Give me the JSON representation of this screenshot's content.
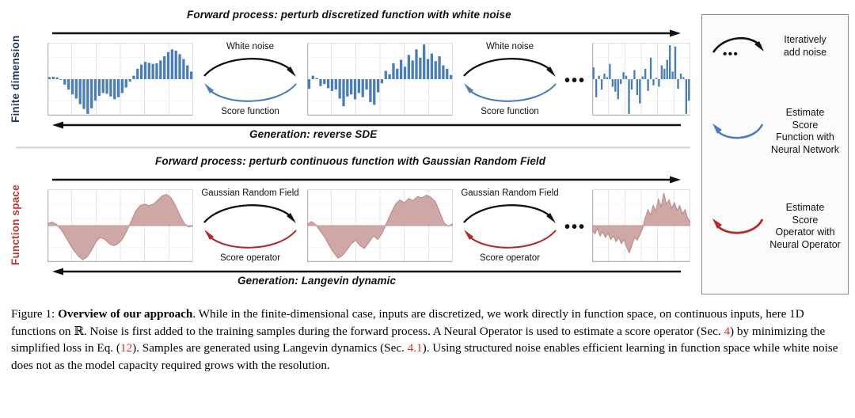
{
  "rows": [
    {
      "id": "finite-dimension",
      "axis_label": "Finite dimension",
      "axis_color": "#1F3864",
      "forward_caption": "Forward process: perturb discretized function with white noise",
      "reverse_caption": "Generation: reverse SDE",
      "connector_top_label": "White noise",
      "connector_bottom_label": "Score function",
      "series_color": "#4A7EBB",
      "ellipsis": "•••"
    },
    {
      "id": "function-space",
      "axis_label": "Function space",
      "axis_color": "#C0392B",
      "forward_caption": "Forward process: perturb continuous function with Gaussian Random Field",
      "reverse_caption": "Generation: Langevin dynamic",
      "connector_top_label": "Gaussian Random Field",
      "connector_bottom_label": "Score operator",
      "series_color": "#C0392B",
      "fill_color": "#CCA0A0",
      "ellipsis": "•••"
    }
  ],
  "legend": {
    "items": [
      {
        "glyph": "black-arc-arrow-with-dots",
        "color": "#111111",
        "dots": "•••",
        "label": "Iteratively\nadd noise"
      },
      {
        "glyph": "blue-arc-arrow-left",
        "color": "#4A7EBB",
        "dots": "",
        "label": "Estimate\nScore\nFunction with\nNeural Network"
      },
      {
        "glyph": "red-arc-arrow-left",
        "color": "#B52A26",
        "dots": "",
        "label": "Estimate\nScore\nOperator with\nNeural Operator"
      }
    ]
  },
  "caption": {
    "figure_label": "Figure 1:",
    "bold_title": "Overview of our approach",
    "part1": ". While in the finite-dimensional case, inputs are discretized, we work directly in function space, on continuous inputs, here 1D functions on ",
    "blackboard_R": "ℝ",
    "part2": ". Noise is first added to the training samples during the forward process. A Neural Operator is used to estimate a score operator (Sec. ",
    "ref_sec4": "4",
    "part3": ") by minimizing the simplified loss in Eq. (",
    "ref_eq12": "12",
    "part4": "). Samples are generated using Langevin dynamics (Sec. ",
    "ref_sec41": "4.1",
    "part5": "). Using structured noise enables efficient learning in function space while white noise does not as the model capacity required grows with the resolution."
  },
  "chart_data": [
    {
      "type": "bar",
      "title": "Finite dimension — clean discretized signal",
      "panel": "top-left",
      "xlabel": "",
      "ylabel": "",
      "grid": true,
      "ylim": [
        -1.05,
        1.05
      ],
      "color": "#4A7EBB",
      "values": [
        0.06,
        0.07,
        0.05,
        -0.02,
        -0.16,
        -0.3,
        -0.44,
        -0.56,
        -0.72,
        -0.86,
        -1.0,
        -0.84,
        -0.62,
        -0.48,
        -0.4,
        -0.42,
        -0.5,
        -0.58,
        -0.52,
        -0.4,
        -0.24,
        -0.07,
        0.1,
        0.3,
        0.42,
        0.5,
        0.47,
        0.44,
        0.46,
        0.54,
        0.66,
        0.78,
        0.86,
        0.82,
        0.72,
        0.58,
        0.4,
        0.22
      ]
    },
    {
      "type": "bar",
      "title": "Finite dimension — partially noised signal",
      "panel": "top-middle",
      "xlabel": "",
      "ylabel": "",
      "grid": true,
      "ylim": [
        -1.05,
        1.05
      ],
      "color": "#4A7EBB",
      "values": [
        -0.28,
        0.1,
        0.03,
        -0.2,
        -0.14,
        -0.26,
        -0.34,
        -0.3,
        -0.56,
        -0.78,
        -0.5,
        -0.44,
        -0.58,
        -0.4,
        -0.52,
        -0.3,
        -0.66,
        -0.74,
        -0.38,
        -0.12,
        0.24,
        0.14,
        0.46,
        0.3,
        0.56,
        0.36,
        0.7,
        0.54,
        0.86,
        0.62,
        1.0,
        0.58,
        0.74,
        0.52,
        0.66,
        0.4,
        0.3,
        0.12
      ]
    },
    {
      "type": "bar",
      "title": "Finite dimension — pure white noise",
      "panel": "top-right",
      "xlabel": "",
      "ylabel": "",
      "grid": true,
      "ylim": [
        -1.05,
        1.05
      ],
      "color": "#4A7EBB",
      "values": [
        0.34,
        -0.52,
        0.1,
        -0.3,
        0.16,
        0.06,
        0.44,
        -0.22,
        -0.36,
        -0.58,
        -0.14,
        0.2,
        0.1,
        -1.0,
        -0.3,
        0.26,
        -0.46,
        -0.7,
        0.08,
        0.3,
        -0.34,
        0.62,
        -0.18,
        0.04,
        -0.22,
        0.4,
        0.3,
        0.56,
        0.98,
        0.22,
        0.94,
        -0.28,
        0.16,
        0.06,
        -1.0,
        -0.62
      ]
    },
    {
      "type": "area",
      "title": "Function space — clean continuous function",
      "panel": "bottom-left",
      "xlabel": "",
      "ylabel": "",
      "grid": true,
      "ylim": [
        -1.05,
        1.05
      ],
      "color": "#CCA0A0",
      "values": [
        0.06,
        0.1,
        0.04,
        -0.1,
        -0.3,
        -0.52,
        -0.72,
        -0.88,
        -0.98,
        -0.9,
        -0.7,
        -0.46,
        -0.34,
        -0.4,
        -0.52,
        -0.58,
        -0.52,
        -0.38,
        -0.14,
        0.14,
        0.42,
        0.58,
        0.62,
        0.58,
        0.62,
        0.74,
        0.86,
        0.9,
        0.8,
        0.58,
        0.3,
        0.06,
        -0.04,
        0.0
      ]
    },
    {
      "type": "area",
      "title": "Function space — partially noised function",
      "panel": "bottom-middle",
      "xlabel": "",
      "ylabel": "",
      "grid": true,
      "ylim": [
        -1.05,
        1.05
      ],
      "color": "#CCA0A0",
      "values": [
        0.04,
        0.12,
        0.02,
        -0.16,
        -0.34,
        -0.58,
        -0.78,
        -0.94,
        -0.86,
        -0.7,
        -0.52,
        -0.42,
        -0.58,
        -0.66,
        -0.48,
        -0.3,
        -0.4,
        -0.22,
        0.08,
        0.36,
        0.62,
        0.74,
        0.66,
        0.78,
        0.72,
        0.84,
        0.8,
        0.88,
        0.82,
        0.7,
        0.4,
        0.08,
        -0.02,
        0.06
      ]
    },
    {
      "type": "area",
      "title": "Function space — Gaussian random field noise",
      "panel": "bottom-right",
      "xlabel": "",
      "ylabel": "",
      "grid": true,
      "ylim": [
        -1.05,
        1.05
      ],
      "color": "#CCA0A0",
      "values": [
        -0.1,
        -0.24,
        -0.08,
        -0.3,
        -0.18,
        -0.34,
        -0.22,
        -0.4,
        -0.3,
        -0.46,
        -0.34,
        -0.52,
        -0.4,
        -0.62,
        -0.78,
        -0.56,
        -0.34,
        -0.42,
        -0.26,
        -0.08,
        0.22,
        0.46,
        0.3,
        0.58,
        0.42,
        0.76,
        0.54,
        0.94,
        0.62,
        0.74,
        0.5,
        0.66,
        0.44,
        0.58,
        0.34,
        0.46,
        0.22,
        0.1
      ]
    }
  ]
}
